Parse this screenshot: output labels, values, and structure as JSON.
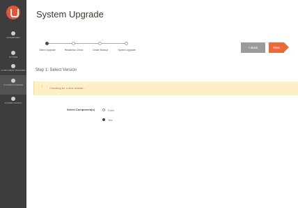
{
  "sidebar": {
    "logo_icon": "magento-logo-icon",
    "items": [
      {
        "label": "DASHBOARD",
        "icon": "dashboard-icon"
      },
      {
        "label": "SYSTEM",
        "icon": "system-icon"
      },
      {
        "label": "COMPONENT MANAGER",
        "icon": "component-manager-icon"
      },
      {
        "label": "SYSTEM UPGRADE",
        "icon": "system-upgrade-icon",
        "active": true
      },
      {
        "label": "SYSTEM CONFIG",
        "icon": "gear-icon"
      }
    ]
  },
  "header": {
    "title": "System Upgrade"
  },
  "stepper": {
    "steps": [
      {
        "label": "Select Upgrade",
        "active": true
      },
      {
        "label": "Readiness Check"
      },
      {
        "label": "Create Backup"
      },
      {
        "label": "System Upgrade"
      }
    ]
  },
  "actions": {
    "back_label": "< Back",
    "next_label": "Next"
  },
  "step": {
    "heading": "Step 1: Select Version"
  },
  "notice": {
    "icon": "warning-icon",
    "text": "Checking for a new version..."
  },
  "form": {
    "field_label": "Select Component(s)",
    "options": [
      {
        "label": "Core",
        "checked": false
      },
      {
        "label": "Yes",
        "checked": true
      }
    ]
  },
  "colors": {
    "sidebar_bg": "#3d3d3d",
    "accent": "#eb6a3a",
    "notice_bg": "#fdf0c6",
    "back_button": "#9b9b9b"
  }
}
